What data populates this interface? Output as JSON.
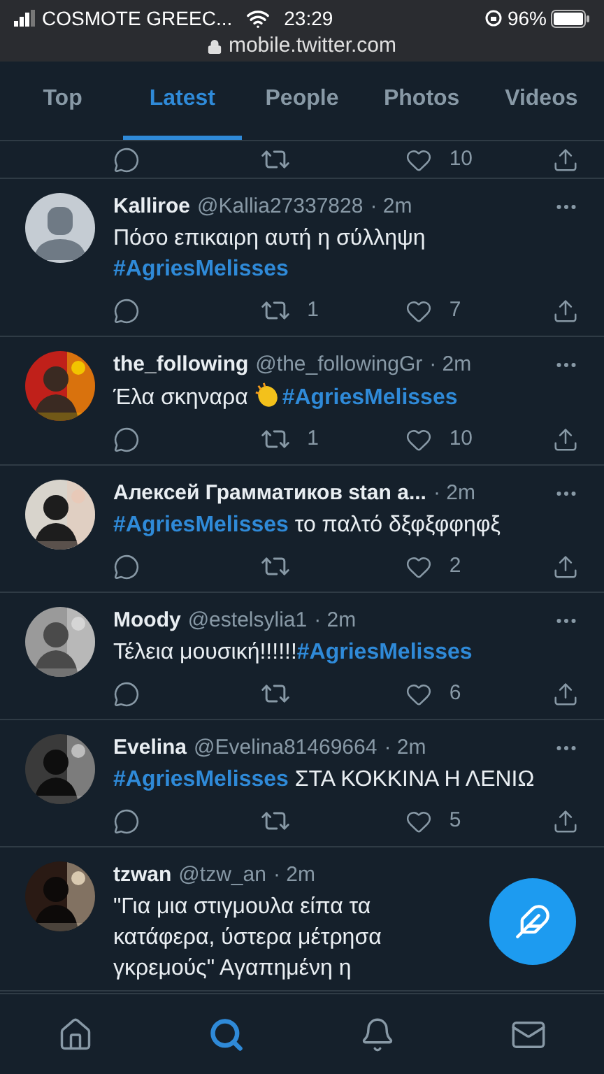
{
  "status_bar": {
    "carrier": "COSMOTE GREEC...",
    "time": "23:29",
    "battery": "96%",
    "url": "mobile.twitter.com"
  },
  "tabs": [
    {
      "label": "Top",
      "selected": false
    },
    {
      "label": "Latest",
      "selected": true
    },
    {
      "label": "People",
      "selected": false
    },
    {
      "label": "Photos",
      "selected": false
    },
    {
      "label": "Videos",
      "selected": false
    }
  ],
  "partial_tweet": {
    "likes": "10"
  },
  "tweets": [
    {
      "avatar": {
        "kind": "default"
      },
      "name": "Kalliroe",
      "handle": "@Kallia27337828",
      "time": "· 2m",
      "text": [
        {
          "kind": "text",
          "text": "Πόσο επικαιρη αυτή η σύλληψη"
        },
        {
          "kind": "break"
        },
        {
          "kind": "hashtag",
          "text": "#AgriesMelisses"
        }
      ],
      "retweets": "1",
      "likes": "7"
    },
    {
      "avatar": {
        "kind": "picture"
      },
      "name": "the_following",
      "handle": "@the_followingGr",
      "time": "· 2m",
      "text": [
        {
          "kind": "text",
          "text": "Έλα σκηναρα "
        },
        {
          "kind": "emoji"
        },
        {
          "kind": "hashtag",
          "text": "#AgriesMelisses"
        }
      ],
      "retweets": "1",
      "likes": "10"
    },
    {
      "avatar": {
        "kind": "picture"
      },
      "name": "Алексей Грамматиков stan a...",
      "time": "· 2m",
      "text": [
        {
          "kind": "hashtag",
          "text": "#AgriesMelisses"
        },
        {
          "kind": "text",
          "text": " το παλτό δξφξφφηφξ"
        }
      ],
      "likes": "2"
    },
    {
      "avatar": {
        "kind": "picture"
      },
      "name": "Moody",
      "handle": "@estelsylia1",
      "time": "· 2m",
      "text": [
        {
          "kind": "text",
          "text": "Τέλεια μουσική!!!!!!"
        },
        {
          "kind": "hashtag",
          "text": "#AgriesMelisses"
        }
      ],
      "likes": "6"
    },
    {
      "avatar": {
        "kind": "picture"
      },
      "name": "Evelina",
      "handle": "@Evelina81469664",
      "time": "· 2m",
      "text": [
        {
          "kind": "hashtag",
          "text": "#AgriesMelisses"
        },
        {
          "kind": "text",
          "text": " ΣΤΑ ΚΟΚΚΙΝΑ Η ΛΕΝΙΩ"
        }
      ],
      "likes": "5"
    },
    {
      "avatar": {
        "kind": "picture"
      },
      "name": "tzwan",
      "handle": "@tzw_an",
      "time": "· 2m",
      "text": [
        {
          "kind": "text",
          "text": "\"Για μια στιγμουλα είπα τα κατάφερα, ύστερα μέτρησα γκρεμούς\" Αγαπημένη η"
        }
      ]
    }
  ],
  "bottom_nav": [
    {
      "kind": "home",
      "selected": false
    },
    {
      "kind": "search",
      "selected": true
    },
    {
      "kind": "notifications",
      "selected": false
    },
    {
      "kind": "messages",
      "selected": false
    }
  ]
}
